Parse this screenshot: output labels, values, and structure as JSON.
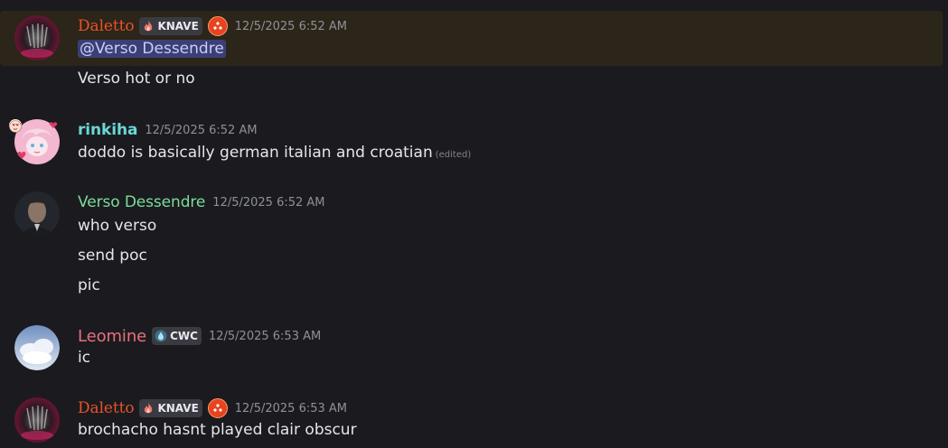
{
  "messages": [
    {
      "user": "Daletto",
      "tag": "KNAVE",
      "timestamp": "12/5/2025 6:52 AM",
      "mention": "@Verso Dessendre",
      "lines": [
        "Verso hot or no"
      ]
    },
    {
      "user": "rinkiha",
      "timestamp": "12/5/2025 6:52 AM",
      "lines": [
        "doddo is basically german italian and croatian"
      ],
      "edited": "(edited)"
    },
    {
      "user": "Verso Dessendre",
      "timestamp": "12/5/2025 6:52 AM",
      "lines": [
        "who verso",
        "send poc",
        "pic"
      ]
    },
    {
      "user": "Leomine",
      "tag": "CWC",
      "timestamp": "12/5/2025 6:53 AM",
      "lines": [
        "ic"
      ]
    },
    {
      "user": "Daletto",
      "tag": "KNAVE",
      "timestamp": "12/5/2025 6:53 AM",
      "lines": [
        "brochacho hasnt played clair obscur"
      ]
    }
  ],
  "colors": {
    "background": "#1b1b1f",
    "highlight": "#2c2519",
    "daletto": "#e8522a",
    "rinkiha": "#6ad7d8",
    "verso": "#7bdc9b",
    "leomine": "#e86f7e",
    "mention_bg": "#3c3f75"
  },
  "icons": {
    "knave_tag": "flame-icon",
    "cwc_tag": "water-drop-icon",
    "boost": "server-boost-icon",
    "rinkiha_decoration": "heart-face-icon"
  }
}
